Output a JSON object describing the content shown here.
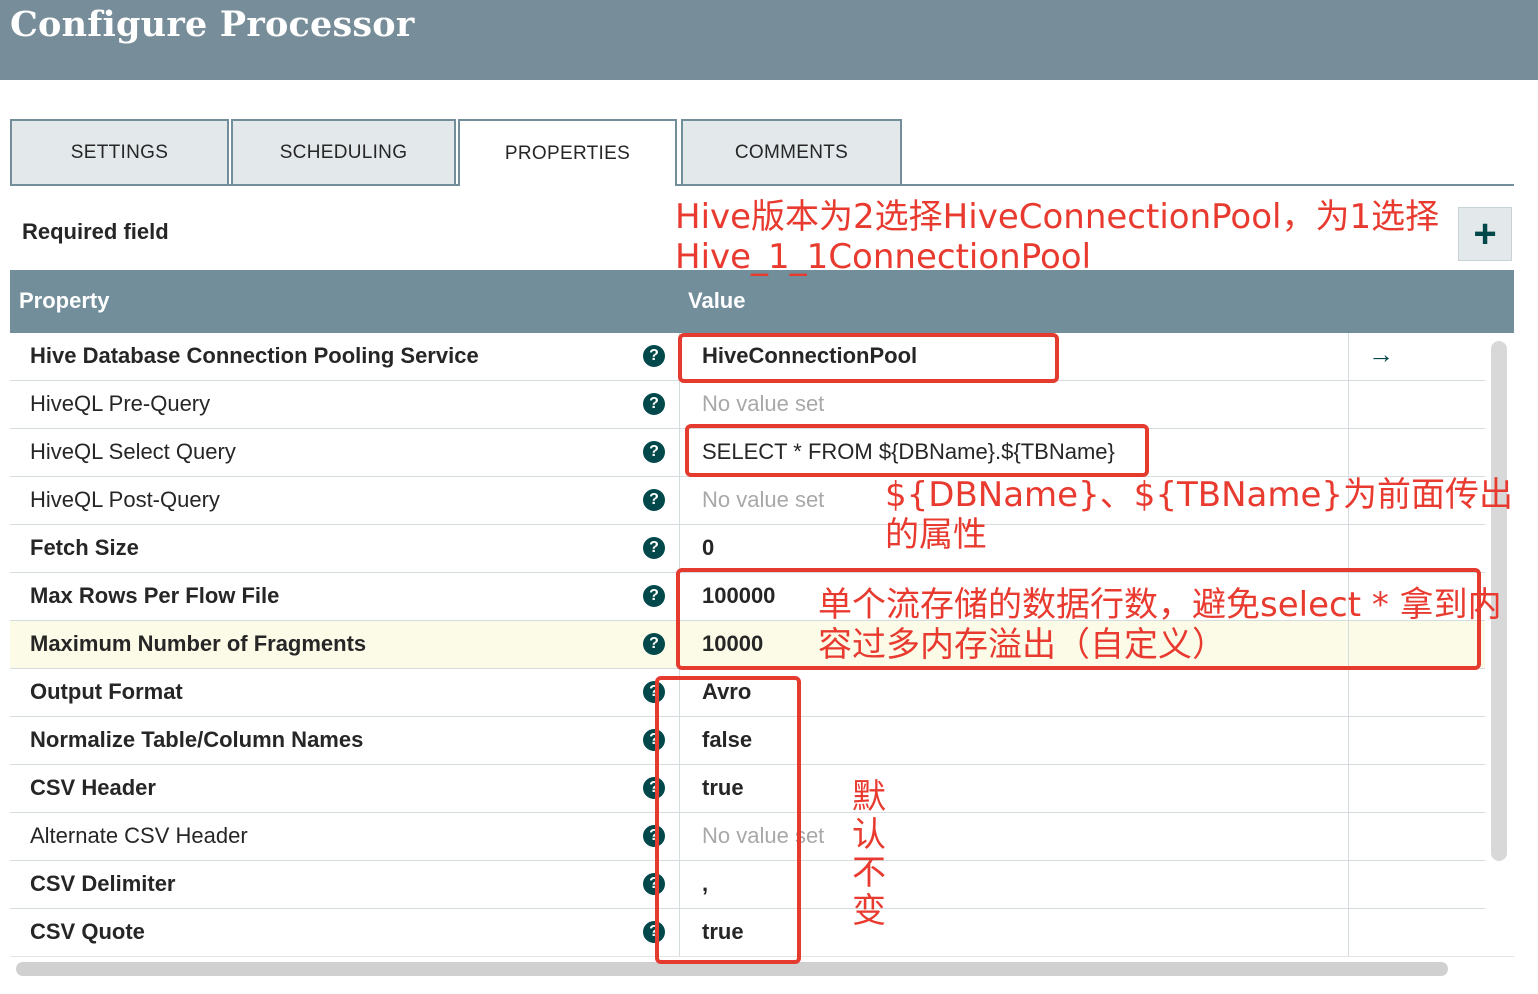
{
  "header": {
    "title": "Configure Processor"
  },
  "tabs": [
    {
      "label": "SETTINGS",
      "active": false
    },
    {
      "label": "SCHEDULING",
      "active": false
    },
    {
      "label": "PROPERTIES",
      "active": true
    },
    {
      "label": "COMMENTS",
      "active": false
    }
  ],
  "required_label": "Required field",
  "add_button_label": "+",
  "grid": {
    "header_property": "Property",
    "header_value": "Value",
    "help_glyph": "?",
    "goto_glyph": "→",
    "rows": [
      {
        "name": "Hive Database Connection Pooling Service",
        "value": "HiveConnectionPool",
        "required": true
      },
      {
        "name": "HiveQL Pre-Query",
        "value": "No value set",
        "required": false
      },
      {
        "name": "HiveQL Select Query",
        "value": "SELECT * FROM ${DBName}.${TBName}",
        "required": false
      },
      {
        "name": "HiveQL Post-Query",
        "value": "No value set",
        "required": false
      },
      {
        "name": "Fetch Size",
        "value": "0",
        "required": true
      },
      {
        "name": "Max Rows Per Flow File",
        "value": "100000",
        "required": true
      },
      {
        "name": "Maximum Number of Fragments",
        "value": "10000",
        "required": true
      },
      {
        "name": "Output Format",
        "value": "Avro",
        "required": true
      },
      {
        "name": "Normalize Table/Column Names",
        "value": "false",
        "required": true
      },
      {
        "name": "CSV Header",
        "value": "true",
        "required": true
      },
      {
        "name": "Alternate CSV Header",
        "value": "No value set",
        "required": false
      },
      {
        "name": "CSV Delimiter",
        "value": ",",
        "required": true
      },
      {
        "name": "CSV Quote",
        "value": "true",
        "required": true
      }
    ]
  },
  "annotations": {
    "note1": "Hive版本为2选择HiveConnectionPool，为1选择Hive_1_1ConnectionPool",
    "note2": "${DBName}、${TBName}为前面传出的属性",
    "note3": "单个流存储的数据行数，避免select * 拿到内容过多内存溢出（自定义）",
    "note4": "默认不变",
    "color": "#e83a2f"
  },
  "colors": {
    "header_bg": "#778d99",
    "grid_header_bg": "#728e9b",
    "help_icon": "#004849",
    "highlight_row": "#fcfbe8"
  }
}
